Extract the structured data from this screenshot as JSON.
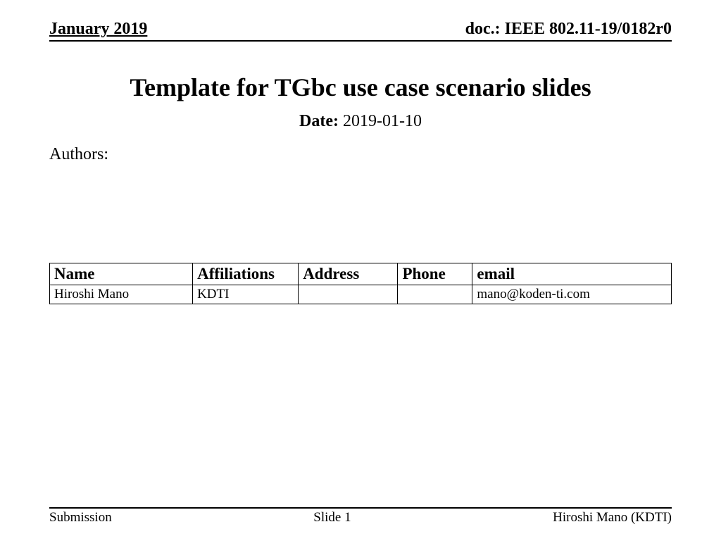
{
  "header": {
    "date_month": "January 2019",
    "doc_id": "doc.: IEEE 802.11-19/0182r0"
  },
  "title": "Template for TGbc use case scenario slides",
  "date": {
    "label": "Date:",
    "value": "2019-01-10"
  },
  "authors_label": "Authors:",
  "table": {
    "headers": {
      "name": "Name",
      "affiliations": "Affiliations",
      "address": "Address",
      "phone": "Phone",
      "email": "email"
    },
    "rows": [
      {
        "name": "Hiroshi Mano",
        "affiliations": "KDTI",
        "address": "",
        "phone": "",
        "email": "mano@koden-ti.com"
      }
    ]
  },
  "footer": {
    "left": "Submission",
    "center": "Slide 1",
    "right": "Hiroshi Mano (KDTI)"
  }
}
